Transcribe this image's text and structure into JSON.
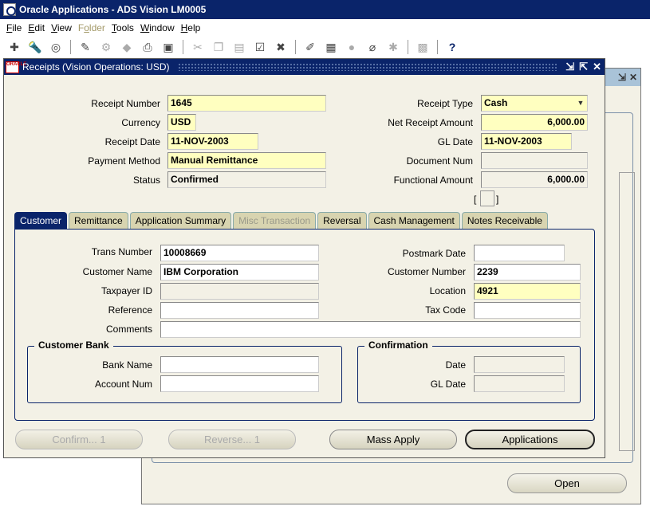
{
  "app": {
    "title": "Oracle Applications - ADS Vision LM0005"
  },
  "menu": [
    {
      "label": "File",
      "disabled": false
    },
    {
      "label": "Edit",
      "disabled": false
    },
    {
      "label": "View",
      "disabled": false
    },
    {
      "label": "Folder",
      "disabled": true
    },
    {
      "label": "Tools",
      "disabled": false
    },
    {
      "label": "Window",
      "disabled": false
    },
    {
      "label": "Help",
      "disabled": false
    }
  ],
  "window": {
    "title": "Receipts (Vision Operations: USD)",
    "icon_text": "ORACLE"
  },
  "receipt": {
    "receipt_number_label": "Receipt Number",
    "receipt_number": "1645",
    "currency_label": "Currency",
    "currency": "USD",
    "receipt_date_label": "Receipt Date",
    "receipt_date": "11-NOV-2003",
    "payment_method_label": "Payment Method",
    "payment_method": "Manual Remittance",
    "status_label": "Status",
    "status": "Confirmed",
    "receipt_type_label": "Receipt Type",
    "receipt_type": "Cash",
    "net_receipt_amount_label": "Net Receipt Amount",
    "net_receipt_amount": "6,000.00",
    "gl_date_label": "GL Date",
    "gl_date": "11-NOV-2003",
    "document_num_label": "Document Num",
    "document_num": "",
    "functional_amount_label": "Functional Amount",
    "functional_amount": "6,000.00",
    "bracket_open": "[",
    "bracket_close": "]"
  },
  "tabs": [
    {
      "label": "Customer",
      "active": true,
      "disabled": false
    },
    {
      "label": "Remittance",
      "active": false,
      "disabled": false
    },
    {
      "label": "Application Summary",
      "active": false,
      "disabled": false
    },
    {
      "label": "Misc Transaction",
      "active": false,
      "disabled": true
    },
    {
      "label": "Reversal",
      "active": false,
      "disabled": false
    },
    {
      "label": "Cash Management",
      "active": false,
      "disabled": false
    },
    {
      "label": "Notes Receivable",
      "active": false,
      "disabled": false
    }
  ],
  "customer": {
    "trans_number_label": "Trans Number",
    "trans_number": "10008669",
    "customer_name_label": "Customer Name",
    "customer_name": "IBM Corporation",
    "taxpayer_id_label": "Taxpayer ID",
    "taxpayer_id": "",
    "reference_label": "Reference",
    "reference": "",
    "comments_label": "Comments",
    "comments": "",
    "postmark_date_label": "Postmark Date",
    "postmark_date": "",
    "customer_number_label": "Customer Number",
    "customer_number": "2239",
    "location_label": "Location",
    "location": "4921",
    "tax_code_label": "Tax Code",
    "tax_code": ""
  },
  "customer_bank": {
    "title": "Customer Bank",
    "bank_name_label": "Bank Name",
    "bank_name": "",
    "account_num_label": "Account Num",
    "account_num": ""
  },
  "confirmation": {
    "title": "Confirmation",
    "date_label": "Date",
    "date": "",
    "gl_date_label": "GL Date",
    "gl_date": ""
  },
  "buttons": {
    "confirm": "Confirm... 1",
    "reverse": "Reverse... 1",
    "mass_apply": "Mass Apply",
    "applications": "Applications",
    "open": "Open"
  }
}
